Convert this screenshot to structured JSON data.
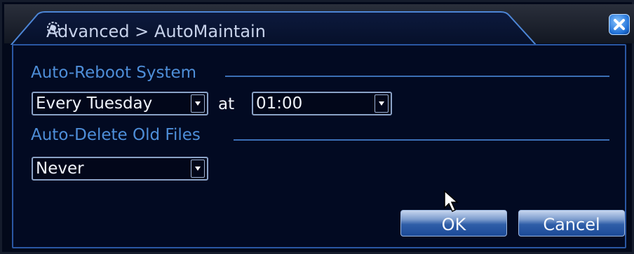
{
  "window": {
    "title": "Advanced > AutoMaintain",
    "close_label": "close",
    "title_icon": "gear-icon"
  },
  "auto_reboot": {
    "section_label": "Auto-Reboot System",
    "day_value": "Every Tuesday",
    "at_label": "at",
    "time_value": "01:00"
  },
  "auto_delete": {
    "section_label": "Auto-Delete Old Files",
    "value": "Never"
  },
  "buttons": {
    "ok_label": "OK",
    "cancel_label": "Cancel"
  },
  "colors": {
    "background": "#03091a",
    "accent": "#2a57a3",
    "section_text": "#4e8ed8",
    "text": "#f0f3fa"
  }
}
